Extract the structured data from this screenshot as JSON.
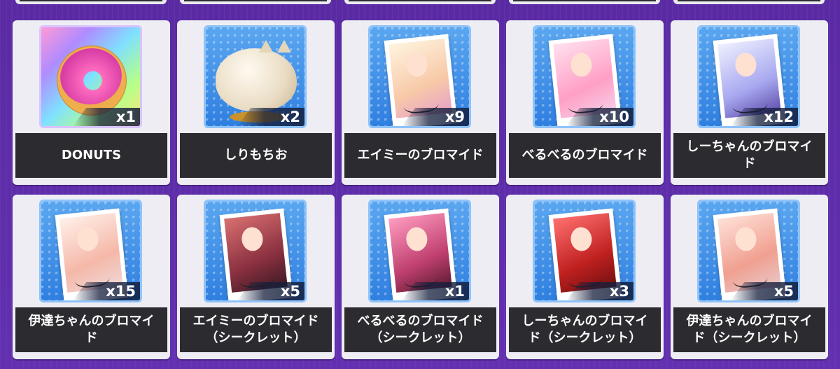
{
  "items": [
    {
      "name": "DONUTS",
      "count": "x1",
      "icon": "donut-icon"
    },
    {
      "name": "しりもちお",
      "count": "x2",
      "icon": "mochi-cat-icon"
    },
    {
      "name": "エイミーのブロマイド",
      "count": "x9",
      "icon": "bromide-icon"
    },
    {
      "name": "べるべるのブロマイド",
      "count": "x10",
      "icon": "bromide-icon"
    },
    {
      "name": "しーちゃんのブロマイド",
      "count": "x12",
      "icon": "bromide-icon"
    },
    {
      "name": "伊達ちゃんのブロマイド",
      "count": "x15",
      "icon": "bromide-icon"
    },
    {
      "name": "エイミーのブロマイド（シークレット）",
      "count": "x5",
      "icon": "bromide-icon"
    },
    {
      "name": "べるべるのブロマイド（シークレット）",
      "count": "x1",
      "icon": "bromide-icon"
    },
    {
      "name": "しーちゃんのブロマイド（シークレット）",
      "count": "x3",
      "icon": "bromide-icon"
    },
    {
      "name": "伊達ちゃんのブロマイド（シークレット）",
      "count": "x5",
      "icon": "bromide-icon"
    }
  ],
  "colors": {
    "background": "#5b2aa6",
    "card": "#eeedf4",
    "label_bar": "#2b2b30",
    "thumb_blue": "#3e8fe6"
  }
}
